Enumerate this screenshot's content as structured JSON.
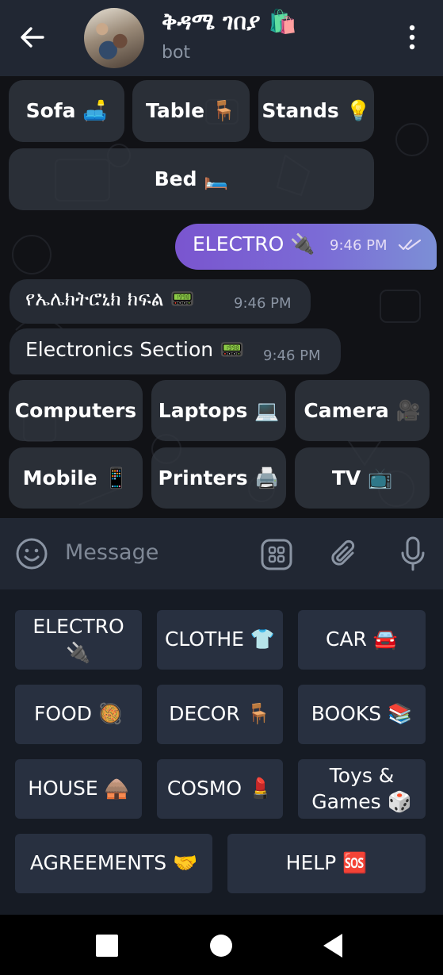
{
  "header": {
    "title": "ቅዳሜ ገበያ 🛍️",
    "subtitle": "bot"
  },
  "chat": {
    "inline_row1": [
      "Sofa 🛋️",
      "Table 🪑",
      "Stands 💡"
    ],
    "inline_row2": [
      "Bed 🛏️"
    ],
    "outgoing": {
      "text": "ELECTRO 🔌",
      "time": "9:46 PM",
      "status": "read"
    },
    "incoming": [
      {
        "text": "የኤሌክትሮኒክ ክፍል 📟",
        "time": "9:46 PM"
      },
      {
        "text": "Electronics Section 📟",
        "time": "9:46 PM"
      }
    ],
    "inline_row3": [
      "Computers",
      "Laptops 💻",
      "Camera 🎥"
    ],
    "inline_row4": [
      "Mobile 📱",
      "Printers 🖨️",
      "TV 📺"
    ]
  },
  "input": {
    "placeholder": "Message"
  },
  "keyboard": {
    "row1": [
      {
        "line1": "ELECTRO",
        "line2": "🔌"
      },
      {
        "line1": "CLOTHE 👕",
        "line2": ""
      },
      {
        "line1": "CAR 🚘",
        "line2": ""
      }
    ],
    "row2": [
      "FOOD 🥘",
      "DECOR 🪑",
      "BOOKS 📚"
    ],
    "row3": [
      {
        "line1": "HOUSE 🛖",
        "line2": ""
      },
      {
        "line1": "COSMO 💄",
        "line2": ""
      },
      {
        "line1": "Toys &",
        "line2": "Games 🎲"
      }
    ],
    "row4": [
      "AGREEMENTS 🤝",
      "HELP 🆘"
    ]
  },
  "colors": {
    "header_bg": "#212733",
    "outgoing_gradient_start": "#7a55cf",
    "outgoing_gradient_end": "#7c8fd6",
    "incoming_bg": "#262b34",
    "keyboard_bg": "#161b24",
    "key_bg": "#283040"
  }
}
